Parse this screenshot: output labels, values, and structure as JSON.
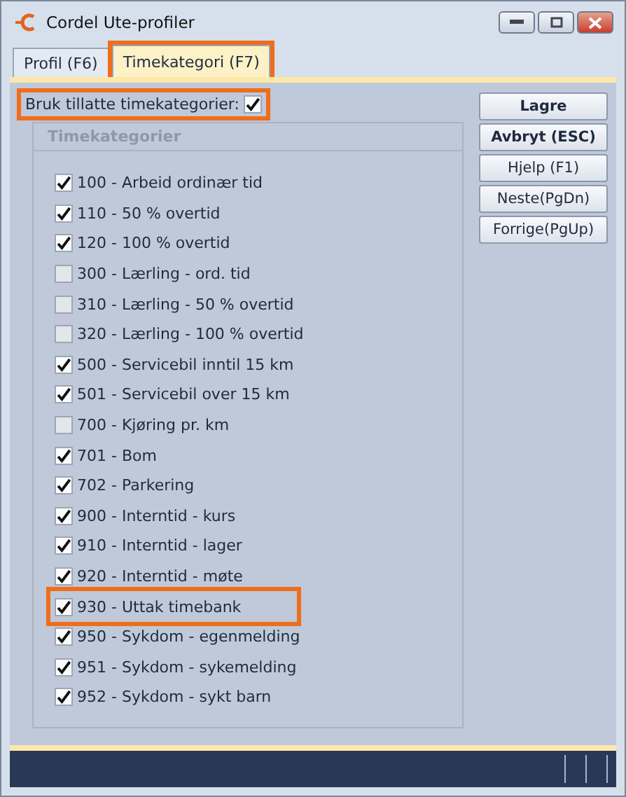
{
  "window": {
    "title": "Cordel Ute-profiler"
  },
  "tabs": [
    {
      "label": "Profil (F6)",
      "selected": false,
      "highlighted": false
    },
    {
      "label": "Timekategori (F7)",
      "selected": true,
      "highlighted": true
    }
  ],
  "enable_option": {
    "label": "Bruk tillatte timekategorier:",
    "checked": true,
    "highlighted": true
  },
  "group": {
    "title": "Timekategorier",
    "items": [
      {
        "label": "100 - Arbeid ordinær tid",
        "checked": true,
        "highlighted": false
      },
      {
        "label": "110 - 50 % overtid",
        "checked": true,
        "highlighted": false
      },
      {
        "label": "120 - 100 % overtid",
        "checked": true,
        "highlighted": false
      },
      {
        "label": "300 - Lærling - ord. tid",
        "checked": false,
        "highlighted": false
      },
      {
        "label": "310 - Lærling - 50 % overtid",
        "checked": false,
        "highlighted": false
      },
      {
        "label": "320 - Lærling - 100 % overtid",
        "checked": false,
        "highlighted": false
      },
      {
        "label": "500 - Servicebil inntil 15 km",
        "checked": true,
        "highlighted": false
      },
      {
        "label": "501 - Servicebil over 15 km",
        "checked": true,
        "highlighted": false
      },
      {
        "label": "700 - Kjøring pr. km",
        "checked": false,
        "highlighted": false
      },
      {
        "label": "701 - Bom",
        "checked": true,
        "highlighted": false
      },
      {
        "label": "702 - Parkering",
        "checked": true,
        "highlighted": false
      },
      {
        "label": "900 - Interntid - kurs",
        "checked": true,
        "highlighted": false
      },
      {
        "label": "910 - Interntid - lager",
        "checked": true,
        "highlighted": false
      },
      {
        "label": "920 - Interntid - møte",
        "checked": true,
        "highlighted": false
      },
      {
        "label": "930 - Uttak timebank",
        "checked": true,
        "highlighted": true
      },
      {
        "label": "950 - Sykdom - egenmelding",
        "checked": true,
        "highlighted": false
      },
      {
        "label": "951 - Sykdom - sykemelding",
        "checked": true,
        "highlighted": false
      },
      {
        "label": "952 - Sykdom - sykt barn",
        "checked": true,
        "highlighted": false
      }
    ]
  },
  "buttons": [
    {
      "label": "Lagre",
      "bold": true
    },
    {
      "label": "Avbryt (ESC)",
      "bold": true
    },
    {
      "label": "Hjelp (F1)",
      "bold": false
    },
    {
      "label": "Neste(PgDn)",
      "bold": false
    },
    {
      "label": "Forrige(PgUp)",
      "bold": false
    }
  ]
}
